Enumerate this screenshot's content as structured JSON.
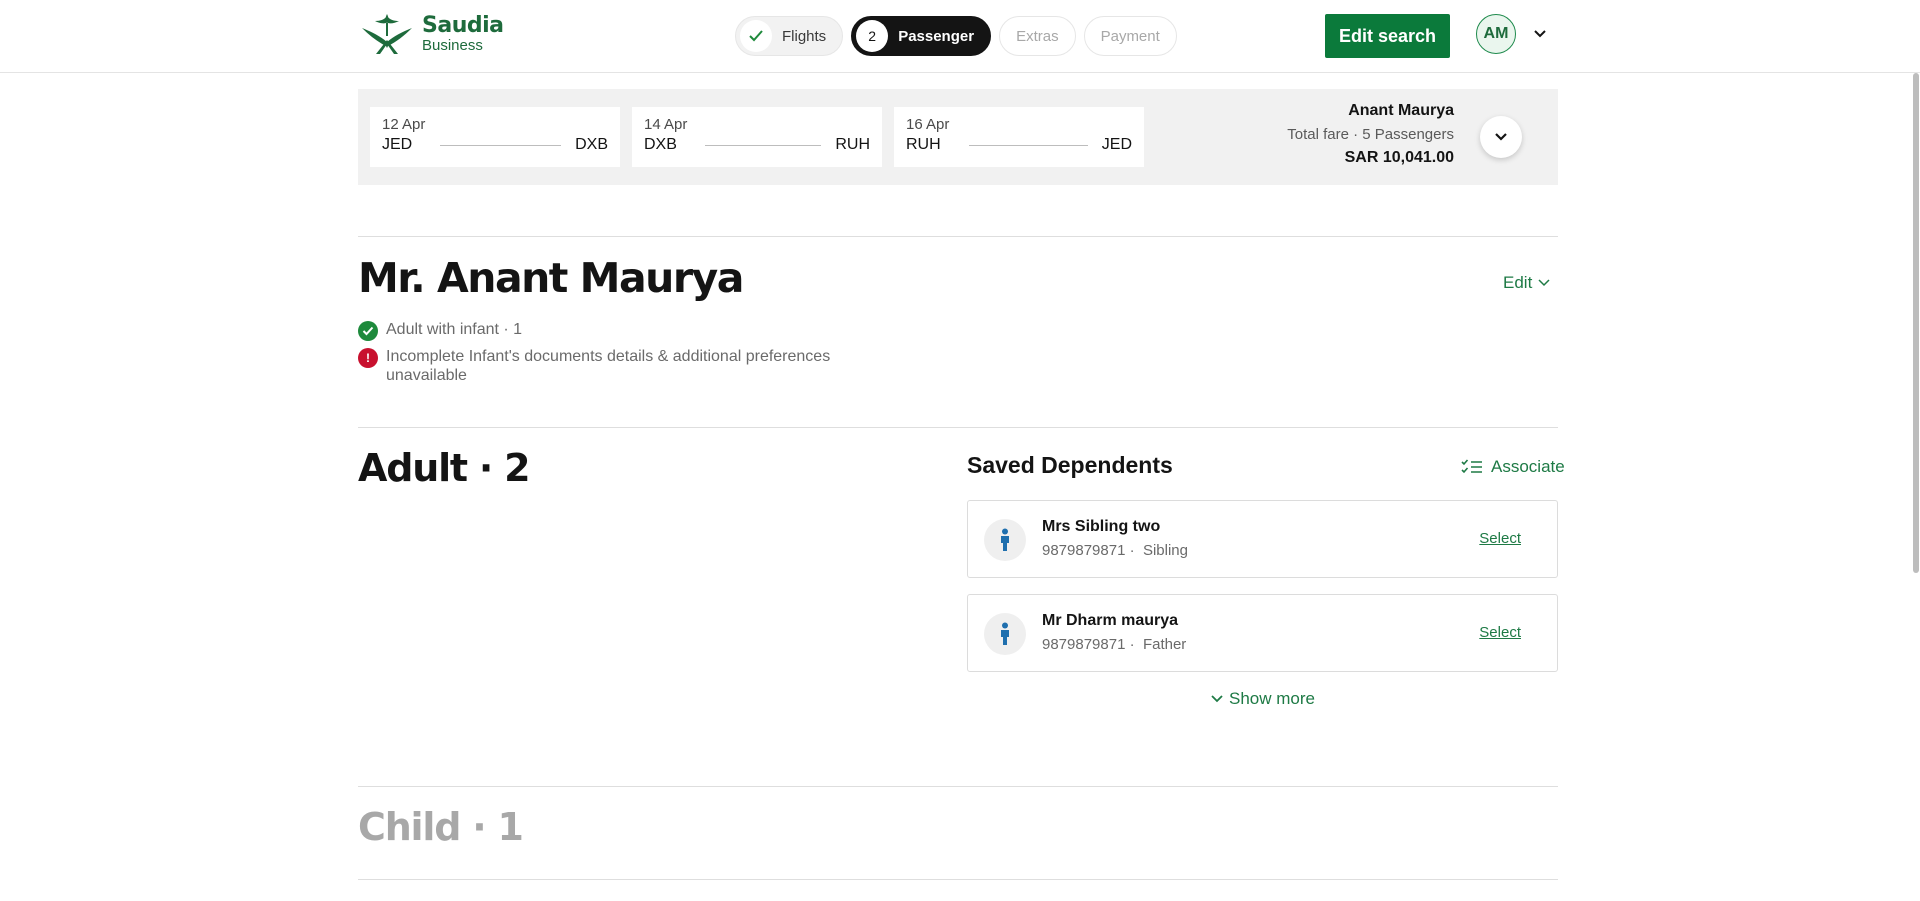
{
  "header": {
    "logo": {
      "brand": "Saudia",
      "sub": "Business"
    },
    "steps": [
      {
        "label": "Flights",
        "state": "done"
      },
      {
        "number": "2",
        "label": "Passenger",
        "state": "active"
      },
      {
        "label": "Extras",
        "state": "upcoming"
      },
      {
        "label": "Payment",
        "state": "upcoming"
      }
    ],
    "edit_search_label": "Edit search",
    "avatar_initials": "AM"
  },
  "itinerary": {
    "legs": [
      {
        "date": "12 Apr",
        "from": "JED",
        "to": "DXB"
      },
      {
        "date": "14 Apr",
        "from": "DXB",
        "to": "RUH"
      },
      {
        "date": "16 Apr",
        "from": "RUH",
        "to": "JED"
      }
    ],
    "fare": {
      "name": "Anant Maurya",
      "description": "Total fare · 5 Passengers",
      "amount": "SAR 10,041.00"
    }
  },
  "passenger": {
    "name": "Mr. Anant Maurya",
    "edit_label": "Edit",
    "statuses": [
      {
        "type": "complete",
        "text": "Adult with infant · 1"
      },
      {
        "type": "error",
        "text": "Incomplete Infant's documents details & additional preferences unavailable"
      }
    ]
  },
  "adult_section": {
    "title": "Adult · 2",
    "saved_dependents": {
      "title": "Saved Dependents",
      "associate_label": "Associate",
      "items": [
        {
          "name": "Mrs Sibling two",
          "phone": "9879879871 ·",
          "relation": "Sibling",
          "select_label": "Select"
        },
        {
          "name": "Mr Dharm maurya",
          "phone": "9879879871 ·",
          "relation": "Father",
          "select_label": "Select"
        }
      ],
      "show_more_label": "Show more"
    }
  },
  "child_section": {
    "title": "Child · 1"
  },
  "colors": {
    "brand_green": "#0b7a3b",
    "link_green": "#1e7a45",
    "success": "#1e8a3c",
    "error": "#c8102e",
    "person_icon": "#1f6fae"
  }
}
